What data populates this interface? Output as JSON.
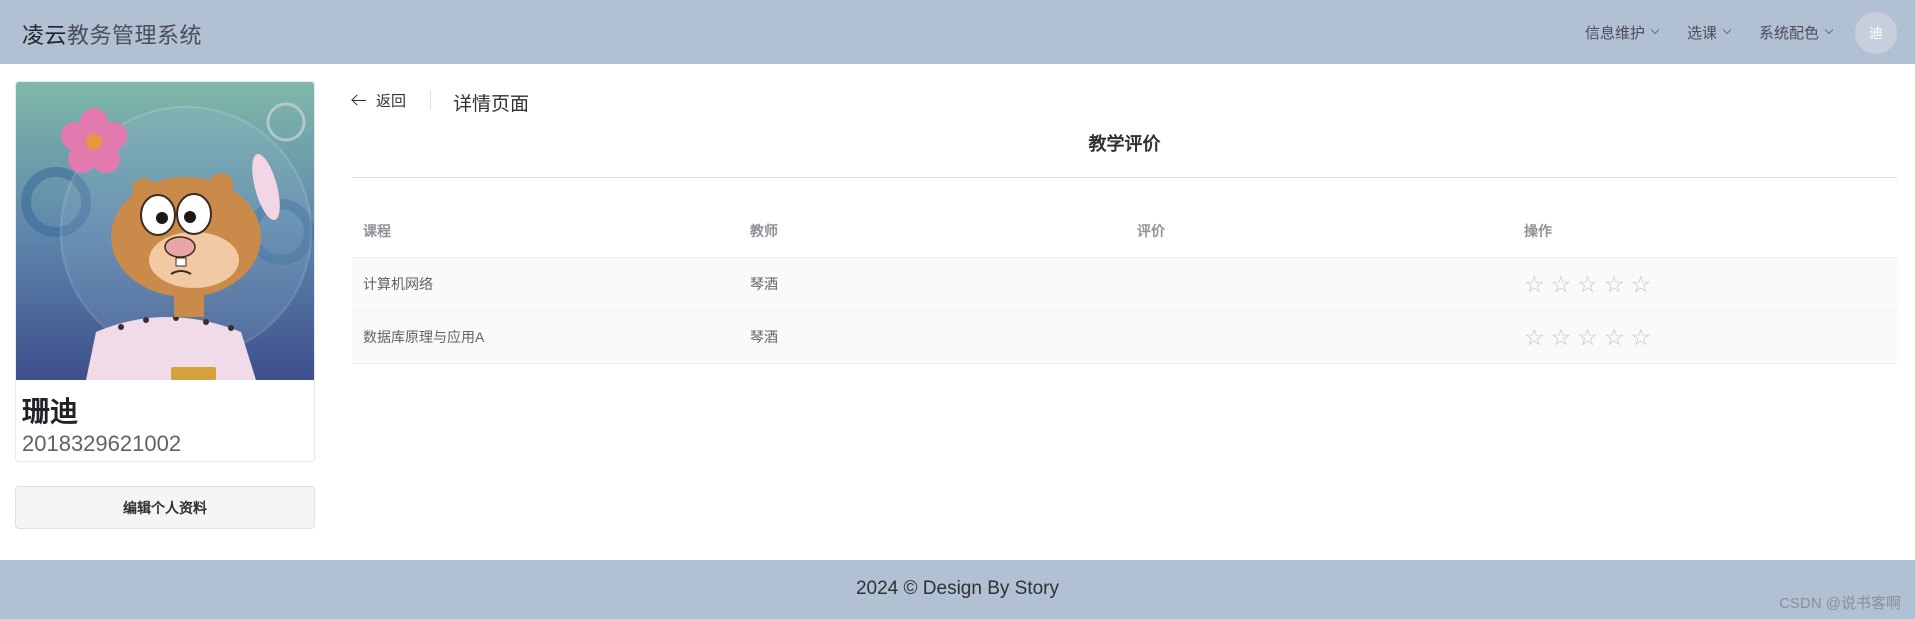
{
  "header": {
    "brand_strong": "凌云",
    "brand_rest": "教务管理系统",
    "nav": [
      {
        "label": "信息维护"
      },
      {
        "label": "选课"
      },
      {
        "label": "系统配色"
      }
    ],
    "avatar_text": "迪"
  },
  "profile": {
    "name": "珊迪",
    "student_id": "2018329621002",
    "edit_label": "编辑个人资料"
  },
  "page": {
    "back_label": "返回",
    "title": "详情页面",
    "section_title": "教学评价"
  },
  "table": {
    "columns": [
      "课程",
      "教师",
      "评价",
      "操作"
    ],
    "rows": [
      {
        "course": "计算机网络",
        "teacher": "琴酒",
        "review": "",
        "rating": 0,
        "max_rating": 5
      },
      {
        "course": "数据库原理与应用A",
        "teacher": "琴酒",
        "review": "",
        "rating": 0,
        "max_rating": 5
      }
    ]
  },
  "footer": {
    "copyright": "2024 © Design By Story",
    "watermark": "CSDN @说书客啊"
  },
  "colors": {
    "header_bg": "#b1c0d3",
    "footer_bg": "#b1c0d3",
    "star_empty": "#c0c4cc"
  }
}
